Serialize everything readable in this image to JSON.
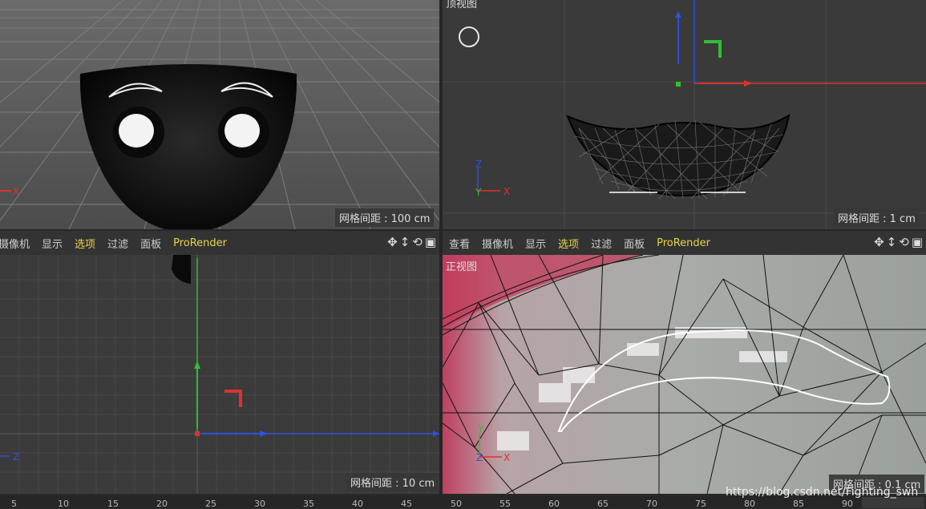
{
  "viewports": {
    "top_left": {
      "grid_spacing": "网格间距 : 100 cm",
      "axis_x": "X"
    },
    "top_right": {
      "title": "顶视图",
      "grid_spacing": "网格间距 : 1 cm",
      "axis_x": "X",
      "axis_y": "Y",
      "axis_z": "Z"
    },
    "bottom_left": {
      "grid_spacing": "网格间距 : 10 cm",
      "axis_z": "Z"
    },
    "bottom_right": {
      "title": "正视图",
      "grid_spacing": "网格间距 : 0.1 cm",
      "axis_x": "X",
      "axis_y": "Y",
      "axis_z": "Z"
    }
  },
  "menu_left": [
    "摄像机",
    "显示",
    "选项",
    "过滤",
    "面板",
    "ProRender"
  ],
  "menu_right": [
    "查看",
    "摄像机",
    "显示",
    "选项",
    "过滤",
    "面板",
    "ProRender"
  ],
  "timeline": {
    "ticks": [
      "5",
      "10",
      "15",
      "20",
      "25",
      "30",
      "35",
      "40",
      "45",
      "50",
      "55",
      "60",
      "65",
      "70",
      "75",
      "80",
      "85",
      "90"
    ]
  },
  "watermark": "https://blog.csdn.net/Fighting_swh",
  "colors": {
    "active_menu": "#e6d44a",
    "axis_x": "#e03030",
    "axis_y": "#30c030",
    "axis_z": "#3050e0"
  }
}
